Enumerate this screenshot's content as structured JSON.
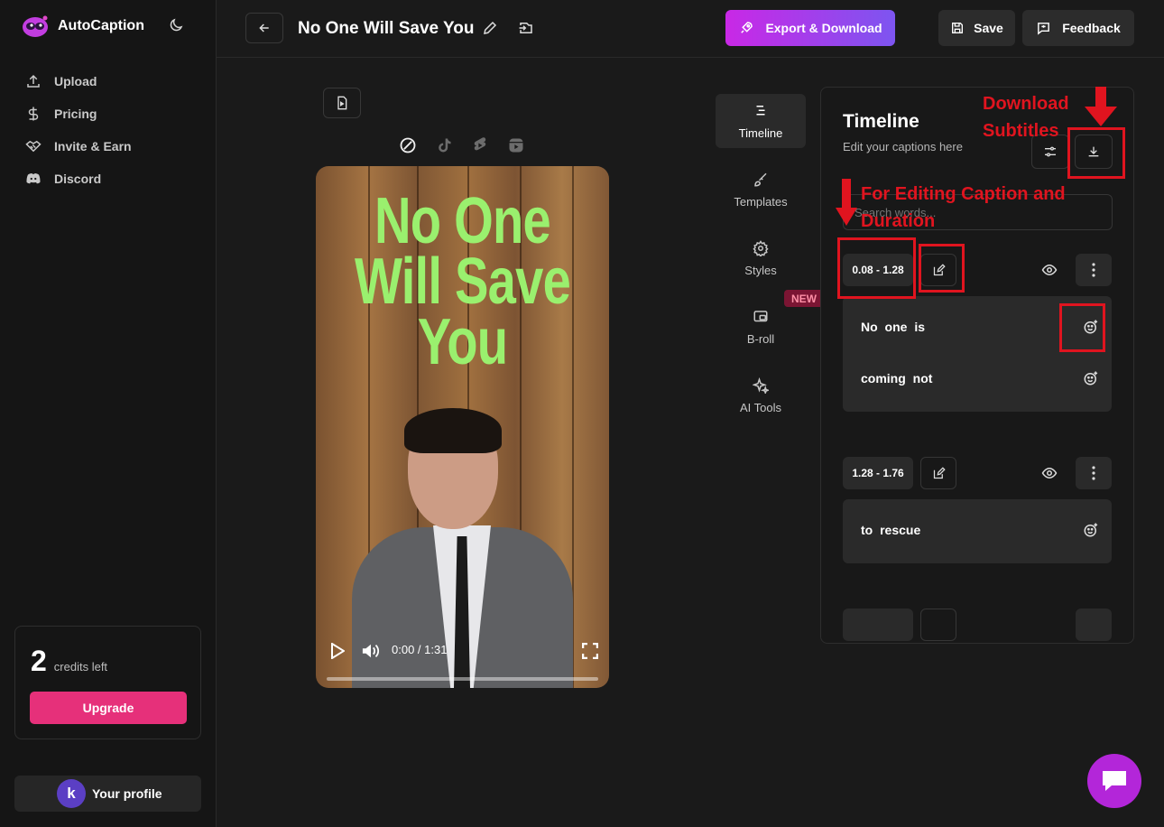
{
  "app": {
    "name": "AutoCaption"
  },
  "sidebar": {
    "items": [
      {
        "label": "Upload",
        "icon": "upload-icon"
      },
      {
        "label": "Pricing",
        "icon": "dollar-icon"
      },
      {
        "label": "Invite & Earn",
        "icon": "handshake-icon"
      },
      {
        "label": "Discord",
        "icon": "discord-icon"
      }
    ],
    "credits": {
      "count": "2",
      "label": "credits left",
      "upgrade_label": "Upgrade"
    },
    "profile": {
      "initial": "k",
      "label": "Your profile"
    }
  },
  "header": {
    "title": "No One Will Save You",
    "export_label": "Export & Download",
    "save_label": "Save",
    "feedback_label": "Feedback"
  },
  "video": {
    "caption_lines": [
      "No One",
      "Will Save",
      "You"
    ],
    "time": "0:00 / 1:31",
    "caption_color": "#9af06e",
    "progress": 0
  },
  "tools": [
    {
      "label": "Timeline",
      "icon": "timeline-icon",
      "active": true
    },
    {
      "label": "Templates",
      "icon": "brush-icon"
    },
    {
      "label": "Styles",
      "icon": "gear-icon"
    },
    {
      "label": "B-roll",
      "icon": "broll-icon"
    },
    {
      "label": "AI Tools",
      "icon": "sparkle-icon"
    }
  ],
  "new_badge": "NEW",
  "timeline": {
    "title": "Timeline",
    "subtitle": "Edit your captions here",
    "search_placeholder": "Search words...",
    "segments": [
      {
        "time": "0.08 - 1.28",
        "lines": [
          "No  one  is",
          "coming  not"
        ]
      },
      {
        "time": "1.28 - 1.76",
        "lines": [
          "to  rescue"
        ]
      }
    ]
  },
  "annotations": {
    "download": "Download Subtitles",
    "editing": "For Editing Caption and Duration",
    "color": "#e0141f"
  },
  "colors": {
    "accent_gradient_start": "#c928e6",
    "accent_gradient_end": "#7d55f0",
    "upgrade": "#e6307a",
    "chat_bubble": "#b326d9"
  }
}
